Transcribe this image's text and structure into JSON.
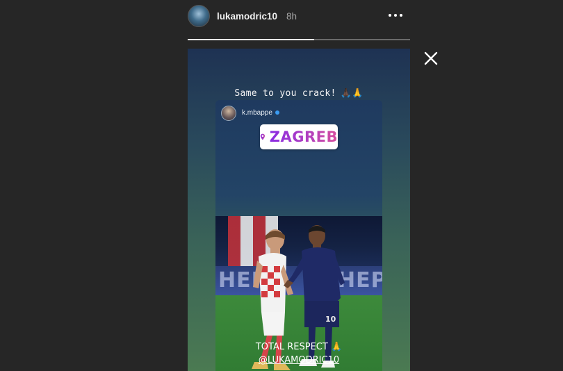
{
  "header": {
    "username": "lukamodric10",
    "time_ago": "8h",
    "more_icon": "more-horizontal-icon",
    "close_icon": "close-icon"
  },
  "progress": {
    "fraction": 0.57
  },
  "story": {
    "reply_text": "Same to you crack!",
    "reply_emoji": "🙏🏿🙏",
    "shared_post": {
      "username": "k.mbappe",
      "verified": true,
      "location_sticker": "ZAGREB",
      "board_text": "HEP",
      "caption_line1": "TOTAL RESPECT",
      "caption_emoji": "🙏",
      "caption_mention": "@LUKAMODRIC10"
    }
  },
  "colors": {
    "background": "#262626",
    "sticker_gradient_start": "#8a2be2",
    "sticker_gradient_end": "#d64d9e",
    "verified_badge": "#3b9cf2"
  }
}
